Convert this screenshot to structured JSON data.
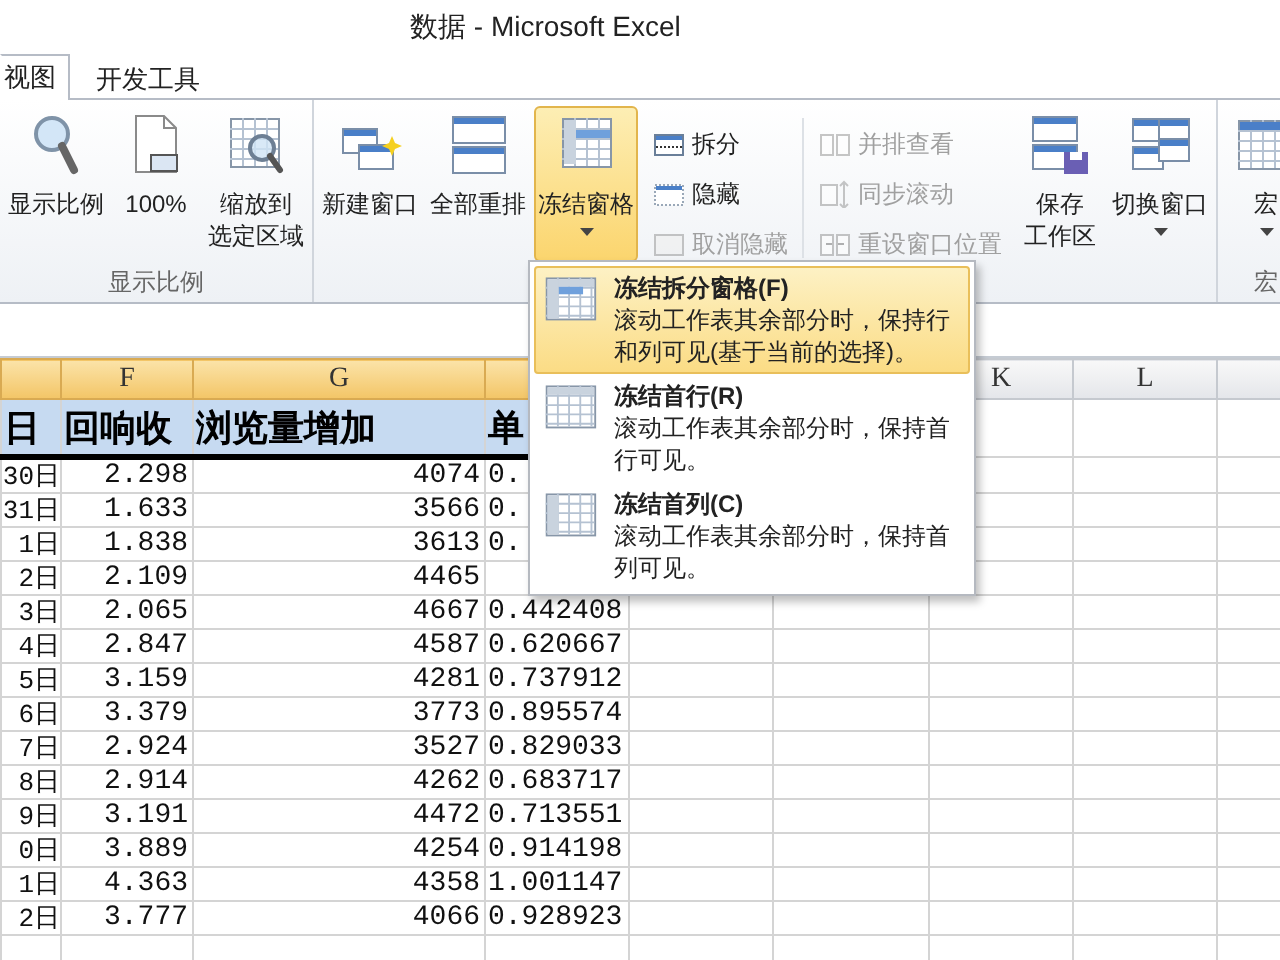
{
  "window": {
    "title": "数据 - Microsoft Excel"
  },
  "tabs": [
    {
      "label": "视图",
      "selected": true
    },
    {
      "label": "开发工具",
      "selected": false
    }
  ],
  "ribbon_groups": [
    {
      "label": "显示比例",
      "buttons": [
        {
          "kind": "large",
          "lines": [
            "显示比例"
          ],
          "dropdown": false,
          "pressed": false
        },
        {
          "kind": "large",
          "lines": [
            "100%"
          ],
          "dropdown": false,
          "pressed": false
        },
        {
          "kind": "large",
          "lines": [
            "缩放到",
            "选定区域"
          ],
          "dropdown": false,
          "pressed": false
        }
      ]
    },
    {
      "buttons": [
        {
          "kind": "large",
          "lines": [
            "新建窗口"
          ],
          "dropdown": false,
          "pressed": false
        },
        {
          "kind": "large",
          "lines": [
            "全部重排"
          ],
          "dropdown": false,
          "pressed": false
        },
        {
          "kind": "large",
          "lines": [
            "冻结窗格"
          ],
          "dropdown": true,
          "pressed": true
        },
        {
          "kind": "small_column",
          "items": [
            {
              "label": "拆分",
              "disabled": false
            },
            {
              "label": "隐藏",
              "disabled": false
            },
            {
              "label": "取消隐藏",
              "disabled": true
            }
          ]
        },
        {
          "kind": "small_column",
          "items": [
            {
              "label": "并排查看",
              "disabled": true
            },
            {
              "label": "同步滚动",
              "disabled": true
            },
            {
              "label": "重设窗口位置",
              "disabled": true
            }
          ]
        },
        {
          "kind": "large",
          "lines": [
            "保存",
            "工作区"
          ],
          "dropdown": false,
          "pressed": false
        },
        {
          "kind": "large",
          "lines": [
            "切换窗口"
          ],
          "dropdown": true,
          "pressed": false
        }
      ]
    },
    {
      "label": "宏",
      "buttons": [
        {
          "kind": "large",
          "lines": [
            "宏"
          ],
          "dropdown": true,
          "pressed": false
        }
      ]
    }
  ],
  "sheet": {
    "columns": [
      {
        "selected": true
      },
      {
        "label": "F",
        "selected": true
      },
      {
        "label": "G",
        "selected": true
      },
      {
        "selected": true
      },
      {
        "label": "K",
        "selected": false
      },
      {
        "label": "L",
        "selected": false
      },
      {
        "selected": false
      }
    ],
    "header_row": [
      "日",
      "回响收",
      "浏览量增加",
      "单"
    ],
    "rows": [
      {
        "cells": [
          "30日",
          "2.298",
          "4074",
          "0."
        ]
      },
      {
        "cells": [
          "31日",
          "1.633",
          "3566",
          "0."
        ]
      },
      {
        "cells": [
          "1日",
          "1.838",
          "3613",
          "0."
        ]
      },
      {
        "cells": [
          "2日",
          "2.109",
          "4465",
          null
        ]
      },
      {
        "cells": [
          "3日",
          "2.065",
          "4667",
          "0.442408"
        ]
      },
      {
        "cells": [
          "4日",
          "2.847",
          "4587",
          "0.620667"
        ]
      },
      {
        "cells": [
          "5日",
          "3.159",
          "4281",
          "0.737912"
        ]
      },
      {
        "cells": [
          "6日",
          "3.379",
          "3773",
          "0.895574"
        ]
      },
      {
        "cells": [
          "7日",
          "2.924",
          "3527",
          "0.829033"
        ]
      },
      {
        "cells": [
          "8日",
          "2.914",
          "4262",
          "0.683717"
        ]
      },
      {
        "cells": [
          "9日",
          "3.191",
          "4472",
          "0.713551"
        ]
      },
      {
        "cells": [
          "0日",
          "3.889",
          "4254",
          "0.914198"
        ]
      },
      {
        "cells": [
          "1日",
          "4.363",
          "4358",
          "1.001147"
        ]
      },
      {
        "cells": [
          "2日",
          "3.777",
          "4066",
          "0.928923"
        ]
      }
    ]
  },
  "menu": {
    "items": [
      {
        "title": "冻结拆分窗格(F)",
        "description": "滚动工作表其余部分时，保持行和列可见(基于当前的选择)。",
        "selected": true
      },
      {
        "title": "冻结首行(R)",
        "description": "滚动工作表其余部分时，保持首行可见。",
        "selected": false
      },
      {
        "title": "冻结首列(C)",
        "description": "滚动工作表其余部分时，保持首列可见。",
        "selected": false
      }
    ]
  }
}
